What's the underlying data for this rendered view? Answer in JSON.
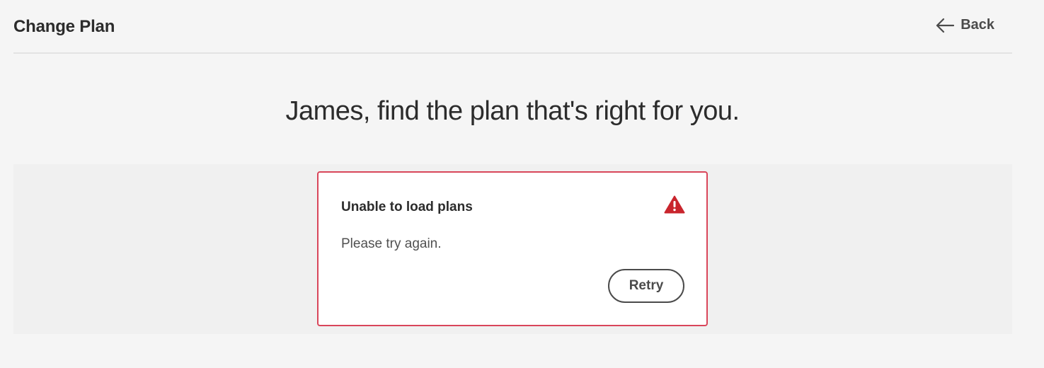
{
  "header": {
    "title": "Change Plan",
    "back_label": "Back",
    "back_icon": "arrow-left-icon"
  },
  "main": {
    "headline": "James, find the plan that's right for you."
  },
  "error_card": {
    "title": "Unable to load plans",
    "message": "Please try again.",
    "retry_label": "Retry",
    "icon": "alert-triangle-icon",
    "border_color": "#d9465a",
    "icon_color": "#c9252d"
  }
}
